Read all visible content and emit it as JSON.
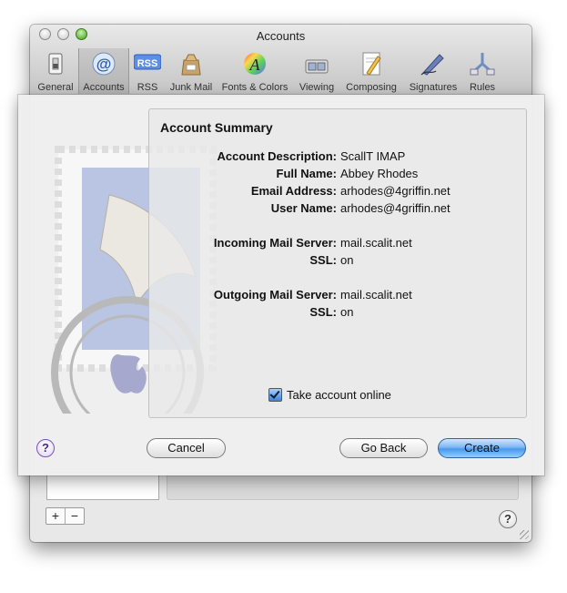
{
  "window": {
    "title": "Accounts",
    "toolbar": [
      {
        "label": "General",
        "icon": "general-switch-icon"
      },
      {
        "label": "Accounts",
        "icon": "at-sign-icon",
        "selected": true
      },
      {
        "label": "RSS",
        "icon": "rss-icon"
      },
      {
        "label": "Junk Mail",
        "icon": "junk-mail-bag-icon"
      },
      {
        "label": "Fonts & Colors",
        "icon": "fonts-colors-icon"
      },
      {
        "label": "Viewing",
        "icon": "viewing-icon"
      },
      {
        "label": "Composing",
        "icon": "composing-pencil-icon"
      },
      {
        "label": "Signatures",
        "icon": "signatures-pen-icon"
      },
      {
        "label": "Rules",
        "icon": "rules-icon"
      }
    ],
    "add_label": "+",
    "remove_label": "−",
    "help_label": "?"
  },
  "sheet": {
    "summary_title": "Account Summary",
    "fields": [
      {
        "label": "Account Description:",
        "value": "ScallT IMAP"
      },
      {
        "label": "Full Name:",
        "value": "Abbey Rhodes"
      },
      {
        "label": "Email Address:",
        "value": "arhodes@4griffin.net"
      },
      {
        "label": "User Name:",
        "value": "arhodes@4griffin.net"
      },
      {
        "label": "Incoming Mail Server:",
        "value": "mail.scalit.net"
      },
      {
        "label": "SSL:",
        "value": "on"
      },
      {
        "label": "Outgoing Mail Server:",
        "value": "mail.scalit.net"
      },
      {
        "label": "SSL:",
        "value": "on"
      }
    ],
    "take_online": {
      "label": "Take account online",
      "checked": true
    },
    "help_label": "?",
    "buttons": {
      "cancel": "Cancel",
      "go_back": "Go Back",
      "create": "Create"
    },
    "colors": {
      "default_button": "#4b98ec",
      "help_accent": "#7d4fbf"
    }
  }
}
